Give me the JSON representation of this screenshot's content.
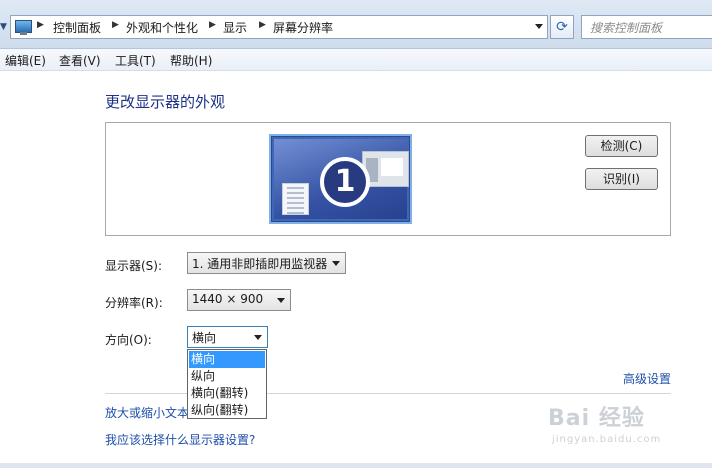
{
  "address_bar": {
    "breadcrumbs": [
      "控制面板",
      "外观和个性化",
      "显示",
      "屏幕分辨率"
    ],
    "search_placeholder": "搜索控制面板",
    "refresh_glyph": "⟳"
  },
  "menu": {
    "items": [
      "编辑(E)",
      "查看(V)",
      "工具(T)",
      "帮助(H)"
    ]
  },
  "main": {
    "title": "更改显示器的外观",
    "monitor_number": "1",
    "detect_button": "检测(C)",
    "identify_button": "识别(I)",
    "display_label": "显示器(S):",
    "display_value": "1. 通用非即插即用监视器",
    "resolution_label": "分辨率(R):",
    "resolution_value": "1440 × 900",
    "orientation_label": "方向(O):",
    "orientation_value": "横向",
    "orientation_options": [
      "横向",
      "纵向",
      "横向(翻转)",
      "纵向(翻转)"
    ],
    "advanced_link": "高级设置",
    "text_size_link": "放大或缩小文本",
    "help_link": "我应该选择什么显示器设置?"
  },
  "watermark": {
    "brand": "Bai 经验",
    "url": "jingyan.baidu.com"
  },
  "colors": {
    "link": "#1e4fa8",
    "title": "#1e3287",
    "selection": "#3399ff",
    "monitor_badge": "#283a80"
  }
}
